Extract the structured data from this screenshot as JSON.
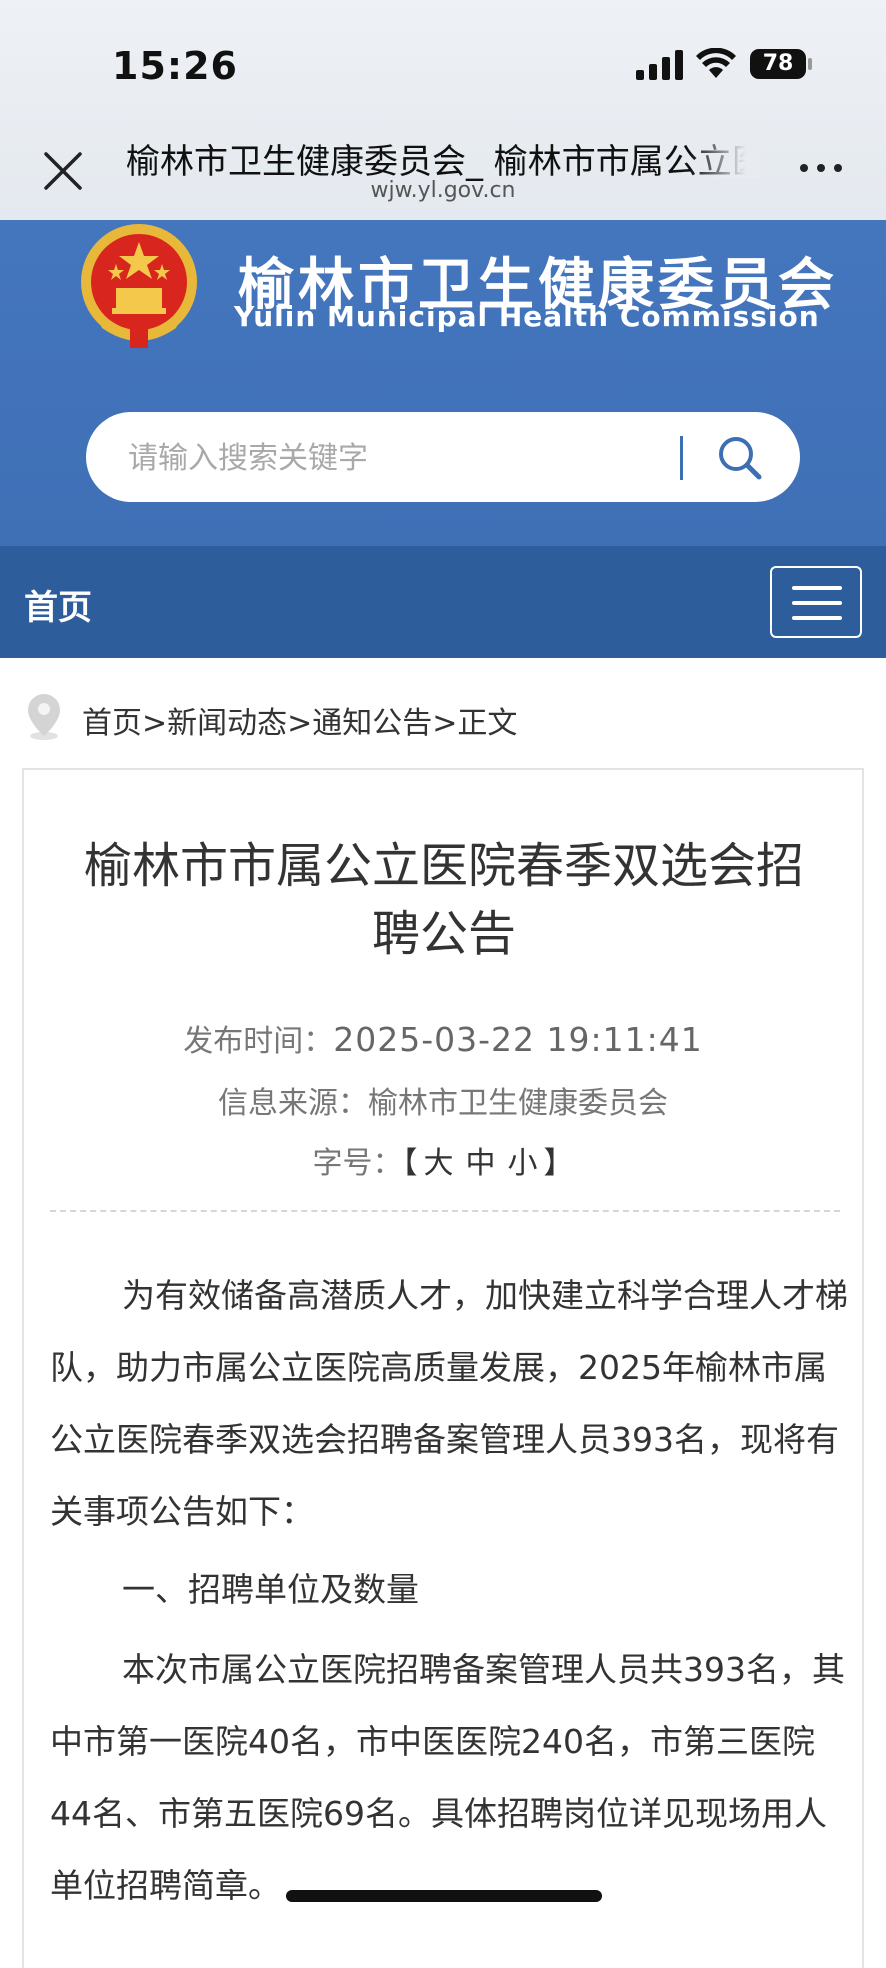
{
  "status_bar": {
    "time": "15:26",
    "battery": "78"
  },
  "browser": {
    "title": "榆林市卫生健康委员会_ 榆林市市属公立医院春季双选会招聘公告",
    "url": "wjw.yl.gov.cn"
  },
  "site": {
    "title_cn": "榆林市卫生健康委员会",
    "title_en": "Yulin Municipal Health Commission",
    "search_placeholder": "请输入搜索关键字"
  },
  "nav": {
    "home": "首页"
  },
  "breadcrumb": {
    "items": [
      "首页",
      "新闻动态",
      "通知公告",
      "正文"
    ],
    "separator": ">"
  },
  "article": {
    "title": "榆林市市属公立医院春季双选会招聘公告",
    "publish_label": "发布时间：",
    "publish_time": "2025-03-22 19:11:41",
    "source_label": "信息来源：",
    "source": "榆林市卫生健康委员会",
    "font_label": "字号：",
    "font_open": "【",
    "font_large": "大",
    "font_medium": "中",
    "font_small": "小",
    "font_close": "】",
    "para1": "为有效储备高潜质人才，加快建立科学合理人才梯队，助力市属公立医院高质量发展，2025年榆林市属公立医院春季双选会招聘备案管理人员393名，现将有关事项公告如下：",
    "section1": "一、招聘单位及数量",
    "para2": "本次市属公立医院招聘备案管理人员共393名，其中市第一医院40名，市中医医院240名，市第三医院44名、市第五医院69名。具体招聘岗位详见现场用人单位招聘简章。"
  },
  "colors": {
    "header_blue": "#4073b8",
    "nav_blue": "#2d5d9b"
  }
}
